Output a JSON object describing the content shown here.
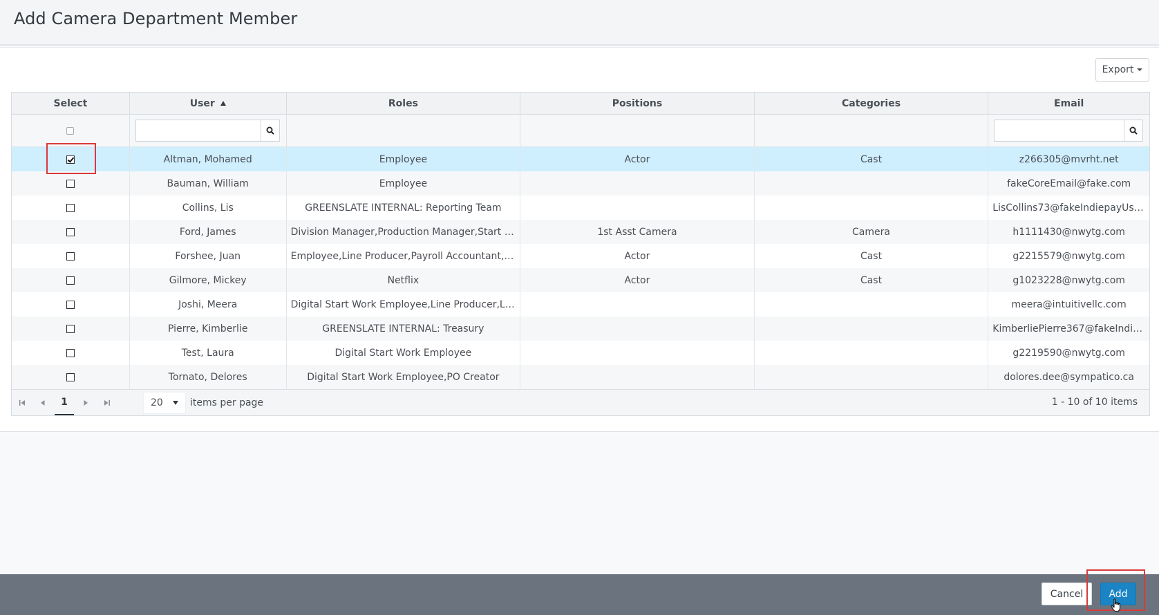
{
  "page": {
    "title": "Add Camera Department Member"
  },
  "toolbar": {
    "export_label": "Export"
  },
  "table": {
    "columns": [
      "Select",
      "User",
      "Roles",
      "Positions",
      "Categories",
      "Email"
    ],
    "sort_icon": "sort-ascending-icon",
    "rows": [
      {
        "checked": true,
        "user": "Altman, Mohamed",
        "roles": "Employee",
        "positions": "Actor",
        "categories": "Cast",
        "email": "z266305@mvrht.net"
      },
      {
        "checked": false,
        "user": "Bauman, William",
        "roles": "Employee",
        "positions": "",
        "categories": "",
        "email": "fakeCoreEmail@fake.com"
      },
      {
        "checked": false,
        "user": "Collins, Lis",
        "roles": "GREENSLATE INTERNAL: Reporting Team",
        "positions": "",
        "categories": "",
        "email": "LisCollins73@fakeIndiepayUse..."
      },
      {
        "checked": false,
        "user": "Ford, James",
        "roles": "Division Manager,Production Manager,Start Wo...",
        "positions": "1st Asst Camera",
        "categories": "Camera",
        "email": "h1111430@nwytg.com"
      },
      {
        "checked": false,
        "user": "Forshee, Juan",
        "roles": "Employee,Line Producer,Payroll Accountant,Sta...",
        "positions": "Actor",
        "categories": "Cast",
        "email": "g2215579@nwytg.com"
      },
      {
        "checked": false,
        "user": "Gilmore, Mickey",
        "roles": "Netflix",
        "positions": "Actor",
        "categories": "Cast",
        "email": "g1023228@nwytg.com"
      },
      {
        "checked": false,
        "user": "Joshi, Meera",
        "roles": "Digital Start Work Employee,Line Producer,LP/P...",
        "positions": "",
        "categories": "",
        "email": "meera@intuitivellc.com"
      },
      {
        "checked": false,
        "user": "Pierre, Kimberlie",
        "roles": "GREENSLATE INTERNAL: Treasury",
        "positions": "",
        "categories": "",
        "email": "KimberliePierre367@fakeIndie..."
      },
      {
        "checked": false,
        "user": "Test, Laura",
        "roles": "Digital Start Work Employee",
        "positions": "",
        "categories": "",
        "email": "g2219590@nwytg.com"
      },
      {
        "checked": false,
        "user": "Tornato, Delores",
        "roles": "Digital Start Work Employee,PO Creator",
        "positions": "",
        "categories": "",
        "email": "dolores.dee@sympatico.ca"
      }
    ]
  },
  "pager": {
    "current_page": "1",
    "page_size": "20",
    "items_per_page_label": "items per page",
    "info": "1 - 10 of 10 items"
  },
  "footer": {
    "cancel_label": "Cancel",
    "add_label": "Add"
  },
  "colors": {
    "selected_row": "#cfeefe",
    "add_button": "#1b84c5",
    "footer_bar": "#6b747e",
    "highlight": "#d93a3a"
  }
}
